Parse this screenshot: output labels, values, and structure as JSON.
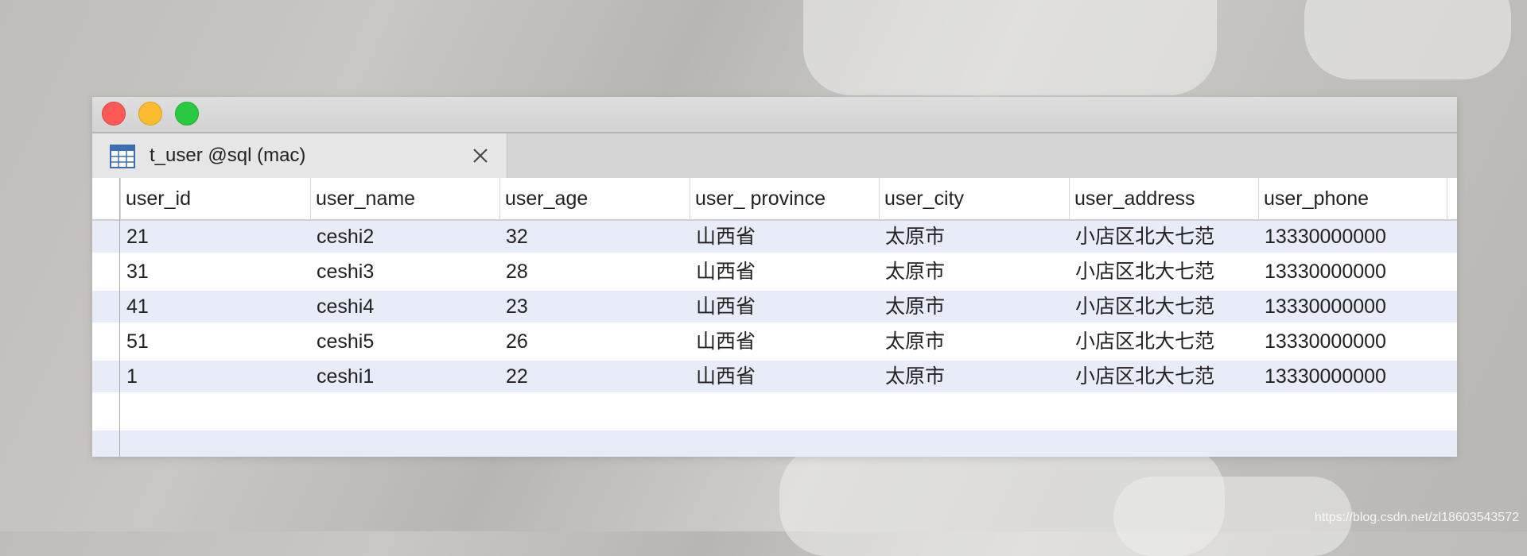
{
  "tab": {
    "title": "t_user @sql (mac)",
    "icon": "table-icon",
    "close_icon": "close-icon"
  },
  "window_controls": {
    "close_color": "#fd5a55",
    "minimize_color": "#fdbb2f",
    "maximize_color": "#29c941"
  },
  "table": {
    "columns": [
      "user_id",
      "user_name",
      "user_age",
      "user_ province",
      "user_city",
      "user_address",
      "user_phone"
    ],
    "rows": [
      [
        "21",
        "ceshi2",
        "32",
        "山西省",
        "太原市",
        "小店区北大七范",
        "13330000000"
      ],
      [
        "31",
        "ceshi3",
        "28",
        "山西省",
        "太原市",
        "小店区北大七范",
        "13330000000"
      ],
      [
        "41",
        "ceshi4",
        "23",
        "山西省",
        "太原市",
        "小店区北大七范",
        "13330000000"
      ],
      [
        "51",
        "ceshi5",
        "26",
        "山西省",
        "太原市",
        "小店区北大七范",
        "13330000000"
      ],
      [
        "1",
        "ceshi1",
        "22",
        "山西省",
        "太原市",
        "小店区北大七范",
        "13330000000"
      ]
    ],
    "alt_row_color": "#e8ecf8"
  },
  "watermark": "https://blog.csdn.net/zl18603543572"
}
